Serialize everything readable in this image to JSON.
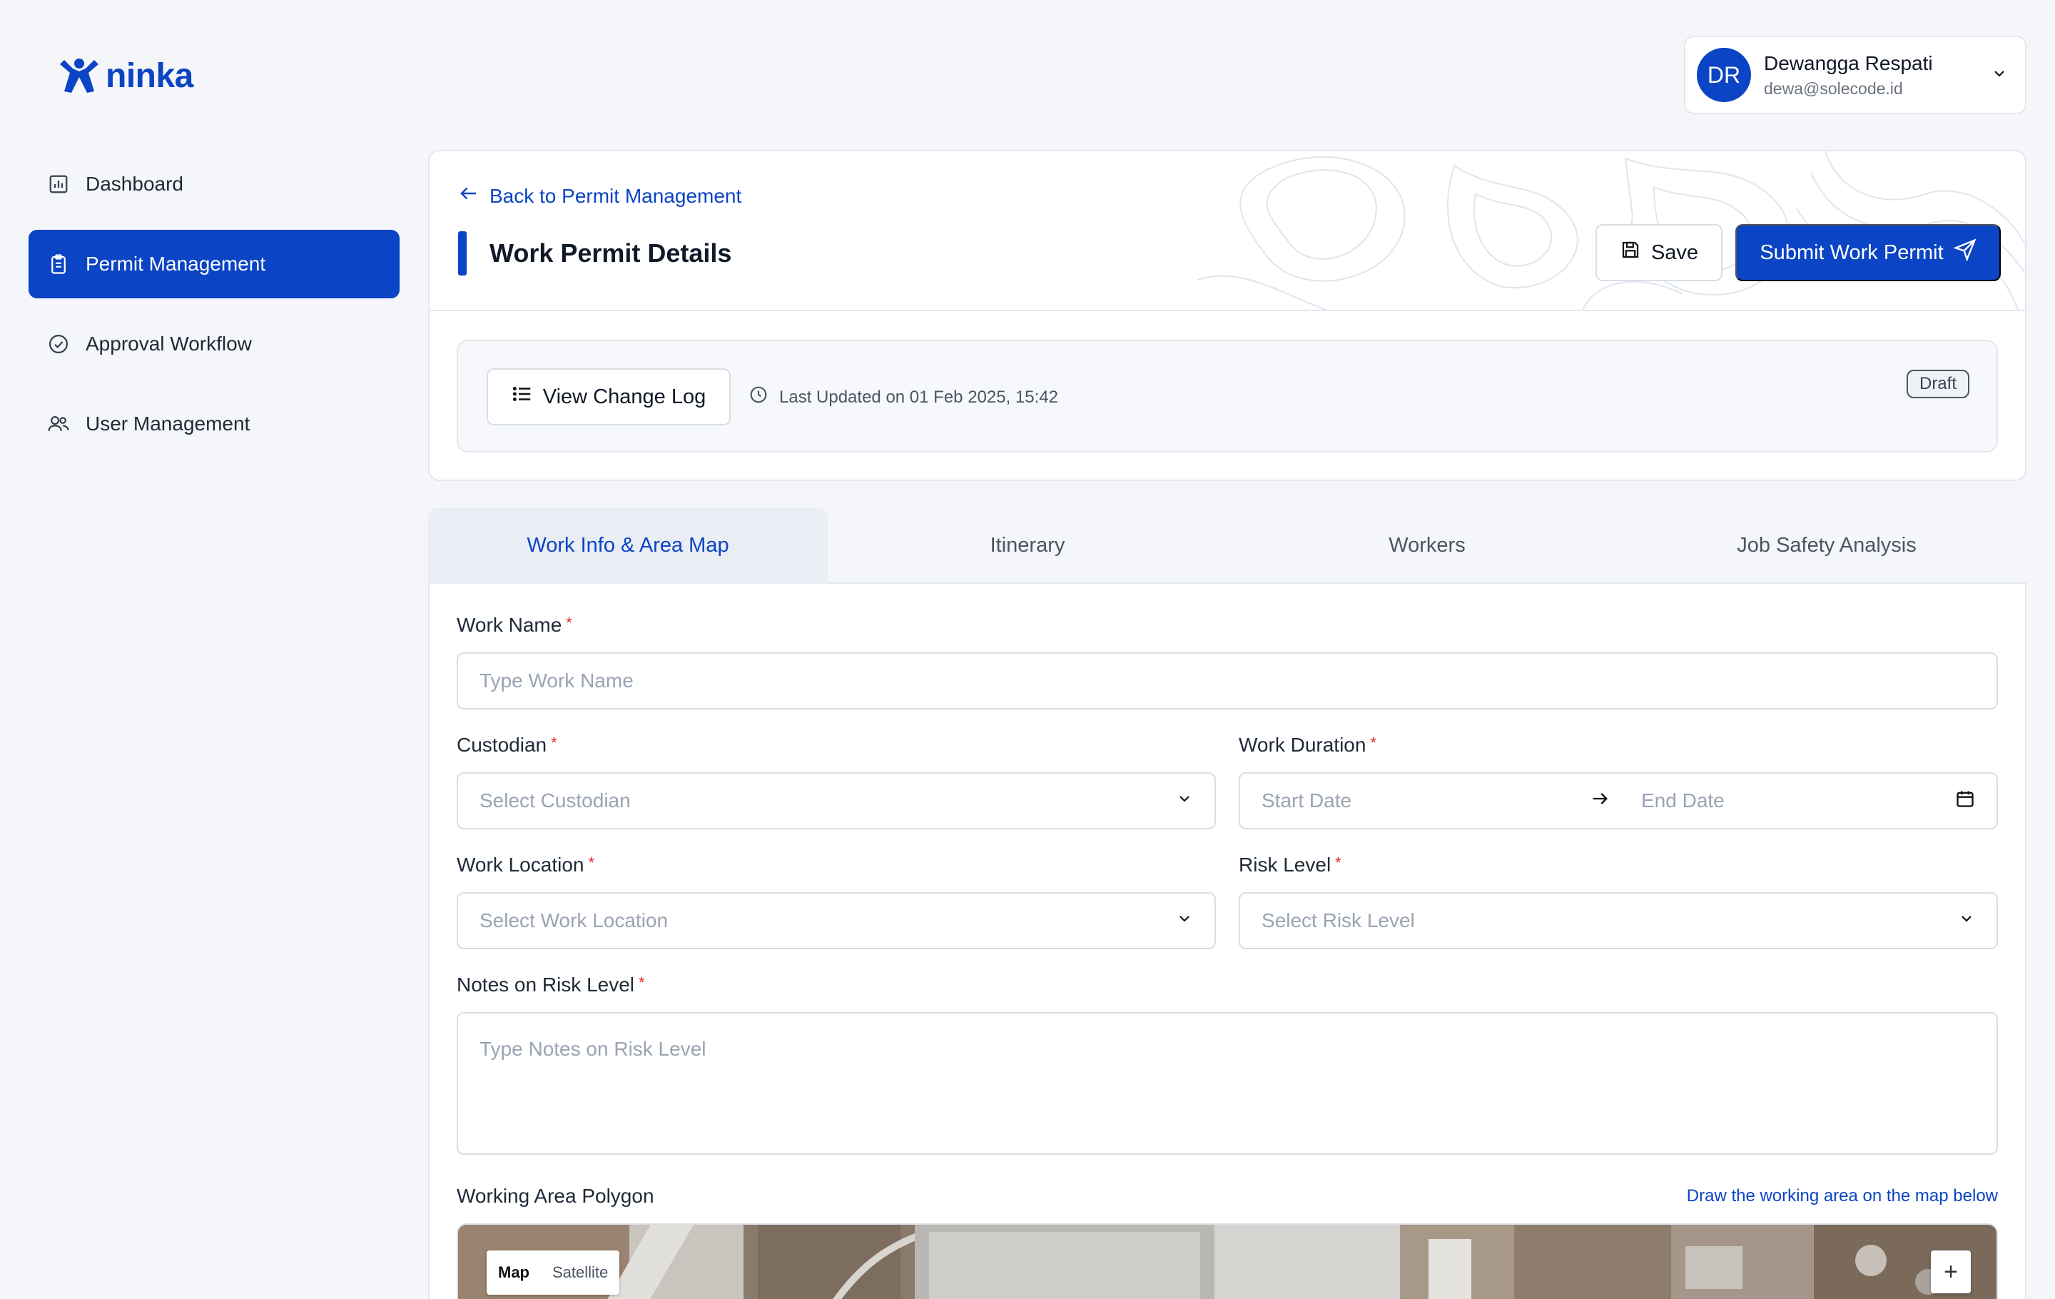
{
  "brand": {
    "name": "ninka",
    "color": "#0b44c4"
  },
  "sidebar": {
    "items": [
      {
        "label": "Dashboard",
        "icon": "chart-icon",
        "active": false
      },
      {
        "label": "Permit Management",
        "icon": "clipboard-icon",
        "active": true
      },
      {
        "label": "Approval Workflow",
        "icon": "check-circle-icon",
        "active": false
      },
      {
        "label": "User Management",
        "icon": "users-icon",
        "active": false
      }
    ]
  },
  "user": {
    "initials": "DR",
    "name": "Dewangga Respati",
    "email": "dewa@solecode.id"
  },
  "header": {
    "back_label": "Back to Permit Management",
    "title": "Work Permit Details",
    "save_label": "Save",
    "submit_label": "Submit Work Permit",
    "changelog_label": "View Change Log",
    "last_updated": "Last Updated on 01 Feb 2025, 15:42",
    "status_badge": "Draft"
  },
  "tabs": [
    {
      "label": "Work Info & Area Map",
      "active": true
    },
    {
      "label": "Itinerary",
      "active": false
    },
    {
      "label": "Workers",
      "active": false
    },
    {
      "label": "Job Safety Analysis",
      "active": false
    }
  ],
  "form": {
    "work_name": {
      "label": "Work Name",
      "required_mark": "*",
      "placeholder": "Type Work Name"
    },
    "custodian": {
      "label": "Custodian",
      "required_mark": "*",
      "placeholder": "Select Custodian"
    },
    "work_duration": {
      "label": "Work Duration",
      "required_mark": "*",
      "start_placeholder": "Start Date",
      "end_placeholder": "End Date"
    },
    "work_location": {
      "label": "Work Location",
      "required_mark": "*",
      "placeholder": "Select Work Location"
    },
    "risk_level": {
      "label": "Risk Level",
      "required_mark": "*",
      "placeholder": "Select Risk Level"
    },
    "risk_notes": {
      "label": "Notes on Risk Level",
      "required_mark": "*",
      "placeholder": "Type Notes on Risk Level"
    },
    "polygon": {
      "label": "Working Area Polygon",
      "hint": "Draw the working area on the map below"
    }
  },
  "map": {
    "type_map": "Map",
    "type_satellite": "Satellite",
    "selected": "Map",
    "zoom_in": "+"
  }
}
